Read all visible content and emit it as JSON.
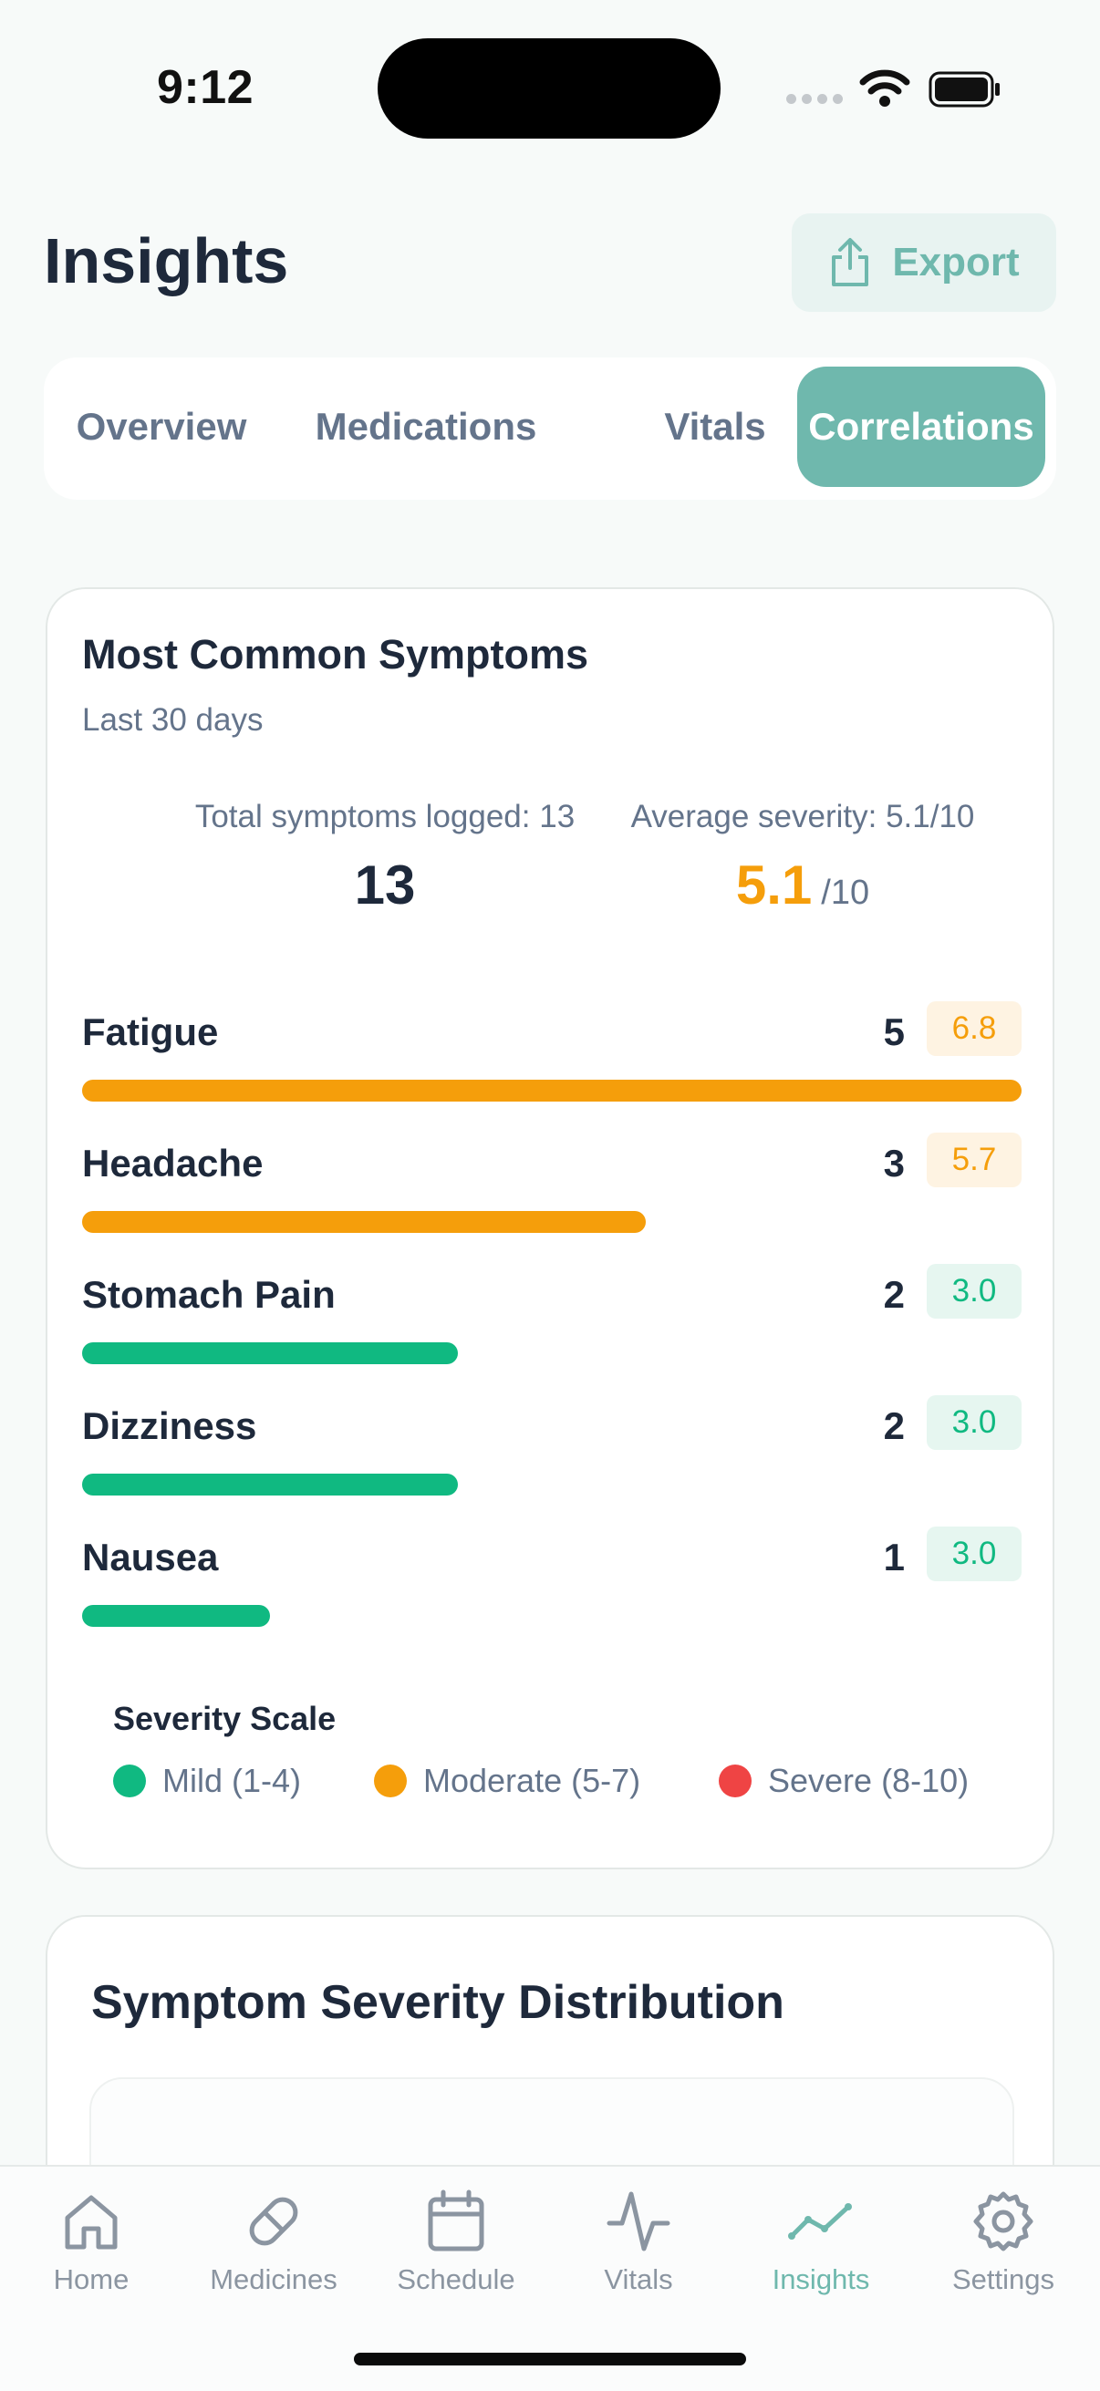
{
  "status_bar": {
    "time": "9:12"
  },
  "header": {
    "title": "Insights",
    "export_label": "Export"
  },
  "tabs": [
    {
      "label": "Overview",
      "active": false
    },
    {
      "label": "Medications",
      "active": false
    },
    {
      "label": "Vitals",
      "active": false
    },
    {
      "label": "Correlations",
      "active": true
    }
  ],
  "symptoms_card": {
    "title": "Most Common Symptoms",
    "subtitle": "Last 30 days",
    "total_label": "Total symptoms logged: 13",
    "total_value": "13",
    "avg_label": "Average severity: 5.1/10",
    "avg_value": "5.1",
    "avg_unit": "/10",
    "items": [
      {
        "name": "Fatigue",
        "count": "5",
        "severity": "6.8",
        "level": "moderate",
        "fraction": 1.0
      },
      {
        "name": "Headache",
        "count": "3",
        "severity": "5.7",
        "level": "moderate",
        "fraction": 0.6
      },
      {
        "name": "Stomach Pain",
        "count": "2",
        "severity": "3.0",
        "level": "mild",
        "fraction": 0.4
      },
      {
        "name": "Dizziness",
        "count": "2",
        "severity": "3.0",
        "level": "mild",
        "fraction": 0.4
      },
      {
        "name": "Nausea",
        "count": "1",
        "severity": "3.0",
        "level": "mild",
        "fraction": 0.2
      }
    ],
    "legend_title": "Severity Scale",
    "legend": [
      {
        "label": "Mild (1-4)",
        "color": "#10b981"
      },
      {
        "label": "Moderate (5-7)",
        "color": "#f59e0b"
      },
      {
        "label": "Severe (8-10)",
        "color": "#ef4444"
      }
    ]
  },
  "distribution_card": {
    "title": "Symptom Severity Distribution"
  },
  "tab_bar": [
    {
      "label": "Home",
      "icon": "home-icon",
      "active": false
    },
    {
      "label": "Medicines",
      "icon": "pill-icon",
      "active": false
    },
    {
      "label": "Schedule",
      "icon": "calendar-icon",
      "active": false
    },
    {
      "label": "Vitals",
      "icon": "pulse-icon",
      "active": false
    },
    {
      "label": "Insights",
      "icon": "trend-icon",
      "active": true
    },
    {
      "label": "Settings",
      "icon": "gear-icon",
      "active": false
    }
  ],
  "colors": {
    "accent": "#6fb8ad",
    "moderate": "#f59e0b",
    "moderate_bg": "#fef3e2",
    "mild": "#10b981",
    "mild_bg": "#e6f6f0"
  }
}
